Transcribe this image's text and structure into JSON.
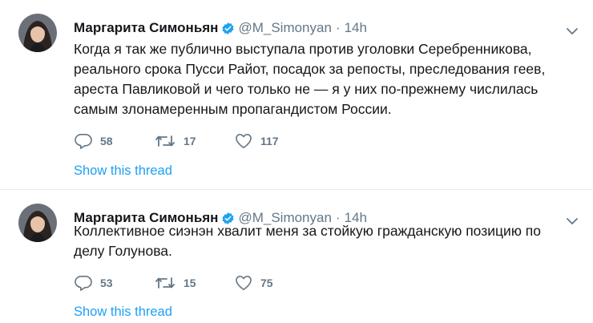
{
  "tweets": [
    {
      "author_name": "Маргарита Симоньян",
      "handle": "@M_Simonyan",
      "separator": "·",
      "time": "14h",
      "text": "Когда я так же публично выступала против уголовки Серебренникова, реального срока Пусси Райот, посадок за репосты, преследования геев, ареста Павликовой и чего только не — я у них по-прежнему числилась самым злонамеренным пропагандистом России.",
      "replies": "58",
      "retweets": "17",
      "likes": "117",
      "thread_link": "Show this thread"
    },
    {
      "author_name": "Маргарита Симоньян",
      "handle": "@M_Simonyan",
      "separator": "·",
      "time": "14h",
      "text": "Коллективное сиэнэн хвалит меня за стойкую гражданскую позицию по делу Голунова.",
      "replies": "53",
      "retweets": "15",
      "likes": "75",
      "thread_link": "Show this thread"
    }
  ],
  "icons": {
    "verified": "verified-badge-icon",
    "caret": "chevron-down-icon",
    "reply": "reply-icon",
    "retweet": "retweet-icon",
    "like": "heart-icon"
  },
  "colors": {
    "accent": "#1da1f2",
    "muted": "#657786",
    "text": "#14171a",
    "divider": "#e6ecf0"
  }
}
